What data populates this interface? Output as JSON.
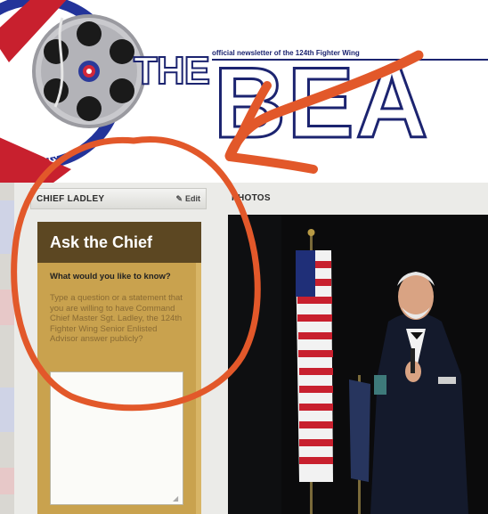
{
  "masthead": {
    "tagline": "official newsletter of the 124th Fighter Wing",
    "wordmark_the": "THE",
    "wordmark_main": "BEA",
    "seal_text": "R WING"
  },
  "chief_panel": {
    "title": "CHIEF LADLEY",
    "edit_label": "Edit",
    "heading": "Ask the Chief",
    "question": "What would you like to know?",
    "prompt": "Type a question or a statement that you are willing to have Command Chief Master Sgt. Ladley, the 124th Fighter Wing Senior Enlisted Advisor answer publicly?",
    "textarea_value": ""
  },
  "photos_panel": {
    "title": "PHOTOS"
  },
  "colors": {
    "brand_navy": "#1c2470",
    "chief_box": "#c9a24e",
    "chief_heading_bg": "#5c4722",
    "annotation_orange": "#e2582a"
  },
  "icons": {
    "edit": "pencil-icon",
    "masthead_emblem": "revolver-cylinder-icon"
  }
}
